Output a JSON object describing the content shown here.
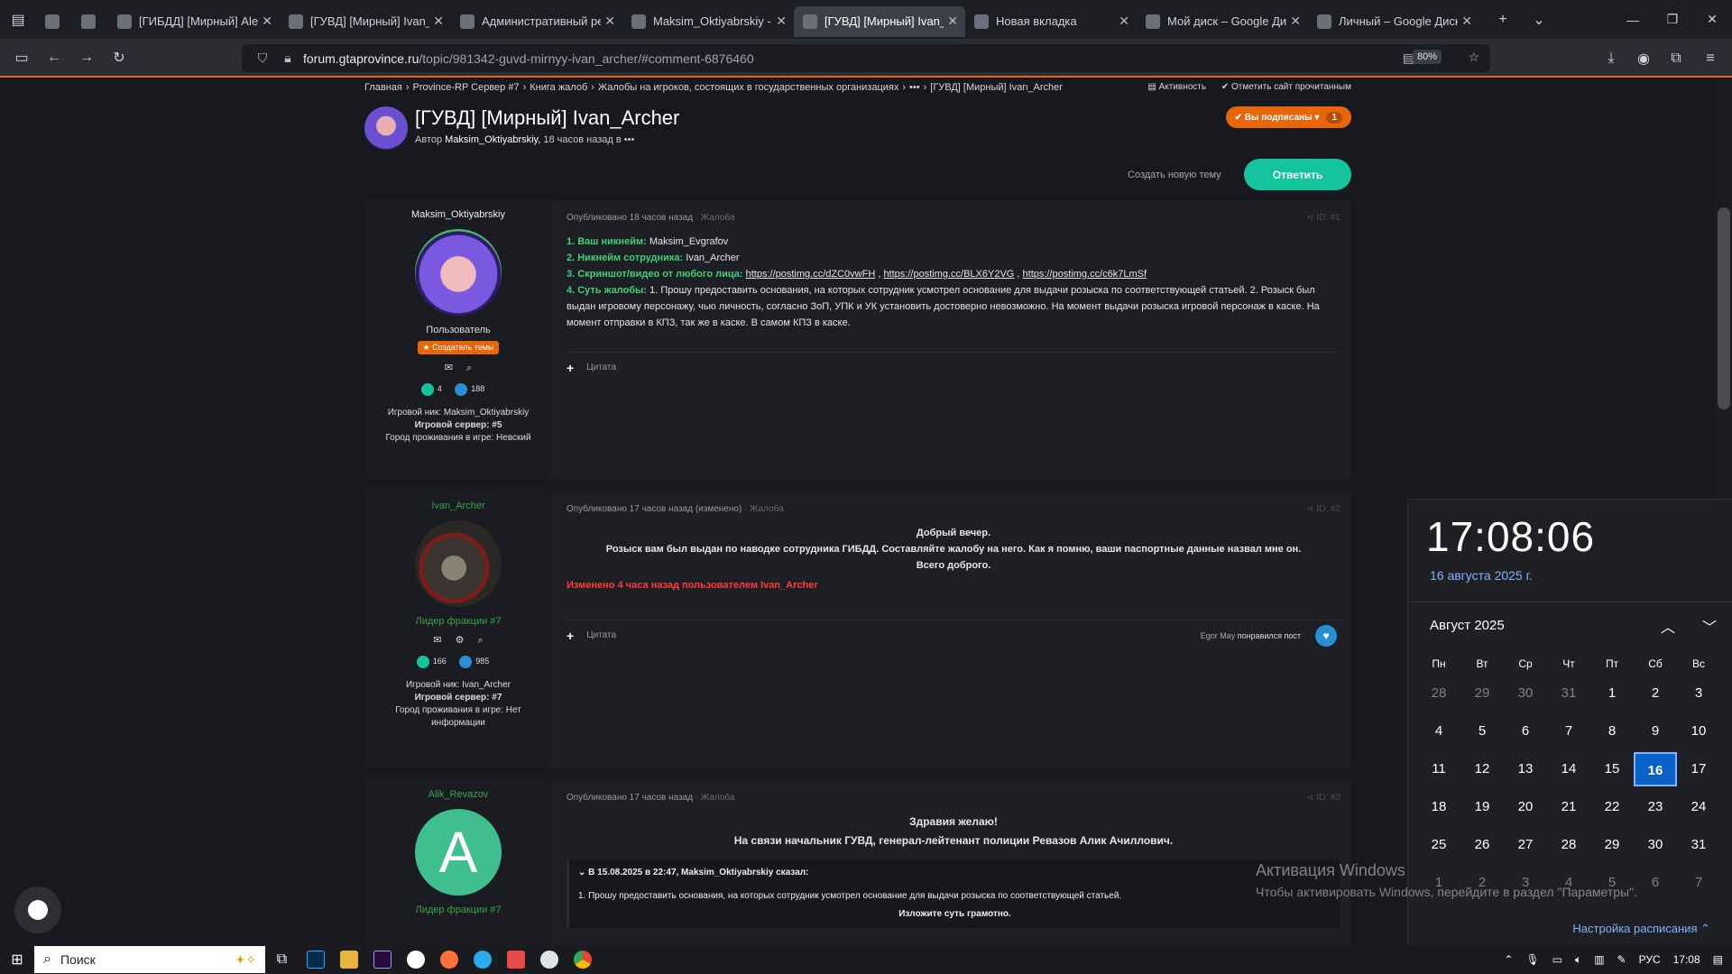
{
  "browser": {
    "tabs": [
      {
        "label": "",
        "active": false,
        "small": true
      },
      {
        "label": "",
        "active": false,
        "small": true
      },
      {
        "label": "[ГИБДД] [Мирный] Alex",
        "active": false
      },
      {
        "label": "[ГУВД] [Мирный] Ivan_A",
        "active": false
      },
      {
        "label": "Административный рег",
        "active": false
      },
      {
        "label": "Maksim_Oktiyabrskiy - M",
        "active": false
      },
      {
        "label": "[ГУВД] [Мирный] Ivan_A",
        "active": true
      },
      {
        "label": "Новая вкладка",
        "active": false
      },
      {
        "label": "Мой диск – Google Диск",
        "active": false
      },
      {
        "label": "Личный – Google Диск",
        "active": false
      }
    ],
    "url_host": "forum.gtaprovince.ru",
    "url_path": "/topic/981342-guvd-mirnyy-ivan_archer/#comment-6876460",
    "zoom": "80%"
  },
  "breadcrumb": {
    "items": [
      "Главная",
      "Province-RP Сервер #7",
      "Книга жалоб",
      "Жалобы на игроков, состоящих в государственных организациях",
      "•••",
      "[ГУВД] [Мирный] Ivan_Archer"
    ],
    "separator": "›",
    "activity": "Активность",
    "mark_read": "Отметить сайт прочитанным"
  },
  "topic": {
    "title": "[ГУВД] [Мирный] Ivan_Archer",
    "meta_prefix": "Автор",
    "author": "Maksim_Oktiyabrskiy,",
    "meta_suffix": "18 часов назад в •••",
    "subscribed_label": "✔ Вы подписаны ▾",
    "subscribed_count": "1",
    "create_topic": "Создать новую тему",
    "reply": "Ответить"
  },
  "posts": [
    {
      "author": "Maksim_Oktiyabrskiy",
      "role": "Пользователь",
      "badge": "★ Создатель темы",
      "likes": "4",
      "posts_count": "188",
      "info_nick": "Игровой ник: Maksim_Oktiyabrskiy",
      "info_server": "Игровой сервер: #5",
      "info_city": "Город проживания в игре: Невский",
      "published": "Опубликовано 18 часов назад",
      "category": "· Жалоба",
      "id": "ID: #1",
      "q1": "1. Ваш никнейм:",
      "a1": " Maksim_Evgrafov",
      "q2": "2. Никнейм сотрудника:",
      "a2": " Ivan_Archer",
      "q3": "3. Скриншот/видео от любого лица:",
      "link1": "https://postimg.cc/dZC0vwFH",
      "link2": "https://postimg.cc/BLX6Y2VG",
      "link3": "https://postimg.cc/c6k7LmSf",
      "q4": "4. Суть жалобы:",
      "a4": " 1. Прошу предоставить основания, на которых сотрудник усмотрел основание для выдачи розыска по соответствующей статьей. 2. Розыск был выдан игровому персонажу, чью личность, согласно ЗоП, УПК и УК установить достоверно невозможно. На момент выдачи розыска игровой персонаж в каске. На момент отправки в КПЗ, так же в каске. В самом КПЗ в каске.",
      "quote": "Цитата"
    },
    {
      "author": "Ivan_Archer",
      "role": "Лидер фракции #7",
      "likes": "166",
      "posts_count": "985",
      "info_nick": "Игровой ник: Ivan_Archer",
      "info_server": "Игровой сервер: #7",
      "info_city": "Город проживания в игре: Нет информации",
      "published": "Опубликовано 17 часов назад (изменено)",
      "category": "· Жалоба",
      "id": "ID: #2",
      "line1": "Добрый вечер.",
      "line2": "Розыск вам был выдан по наводке сотрудника ГИБДД. Составляйте жалобу на него. Как я помню, ваши паспортные данные назвал мне он.",
      "line3": "Всего доброго.",
      "edited": "Изменено 4 часа назад пользователем Ivan_Archer",
      "quote": "Цитата",
      "liker": "Egor May",
      "liked_text": " понравился пост"
    },
    {
      "author": "Alik_Revazov",
      "avatar_letter": "A",
      "role": "Лидер фракции #7",
      "published": "Опубликовано 17 часов назад",
      "category": "· Жалоба",
      "id": "ID: #3",
      "line1": "Здравия желаю!",
      "line2": "На связи начальник ГУВД, генерал-лейтенант полиции Ревазов Алик Ачиллович.",
      "quote_header": "В 15.08.2025 в 22:47, Maksim_Oktiyabrskiy сказал:",
      "quote_body": "1. Прошу предоставить основания, на которых сотрудник усмотрел основание для выдачи розыска по соответствующей статьей.",
      "line3": "Изложите суть грамотно."
    }
  ],
  "clock": {
    "time": "17:08:06",
    "date": "16 августа 2025 г.",
    "month": "Август 2025",
    "weekdays": [
      "Пн",
      "Вт",
      "Ср",
      "Чт",
      "Пт",
      "Сб",
      "Вс"
    ],
    "weeks": [
      [
        "28",
        "29",
        "30",
        "31",
        "1",
        "2",
        "3"
      ],
      [
        "4",
        "5",
        "6",
        "7",
        "8",
        "9",
        "10"
      ],
      [
        "11",
        "12",
        "13",
        "14",
        "15",
        "16",
        "17"
      ],
      [
        "18",
        "19",
        "20",
        "21",
        "22",
        "23",
        "24"
      ],
      [
        "25",
        "26",
        "27",
        "28",
        "29",
        "30",
        "31"
      ],
      [
        "1",
        "2",
        "3",
        "4",
        "5",
        "6",
        "7"
      ]
    ],
    "today": "16",
    "footer": "Настройка расписания ⌃"
  },
  "activation": {
    "title": "Активация Windows",
    "subtitle": "Чтобы активировать Windows, перейдите в раздел \"Параметры\"."
  },
  "taskbar": {
    "search": "Поиск",
    "lang": "РУС",
    "time": "17:08"
  },
  "colors": {
    "accent": "#e8650a",
    "green_button": "#14c49c",
    "question_green": "#3ed17a",
    "edited_red": "#ff3b3b",
    "today_blue": "#0a61c7"
  }
}
